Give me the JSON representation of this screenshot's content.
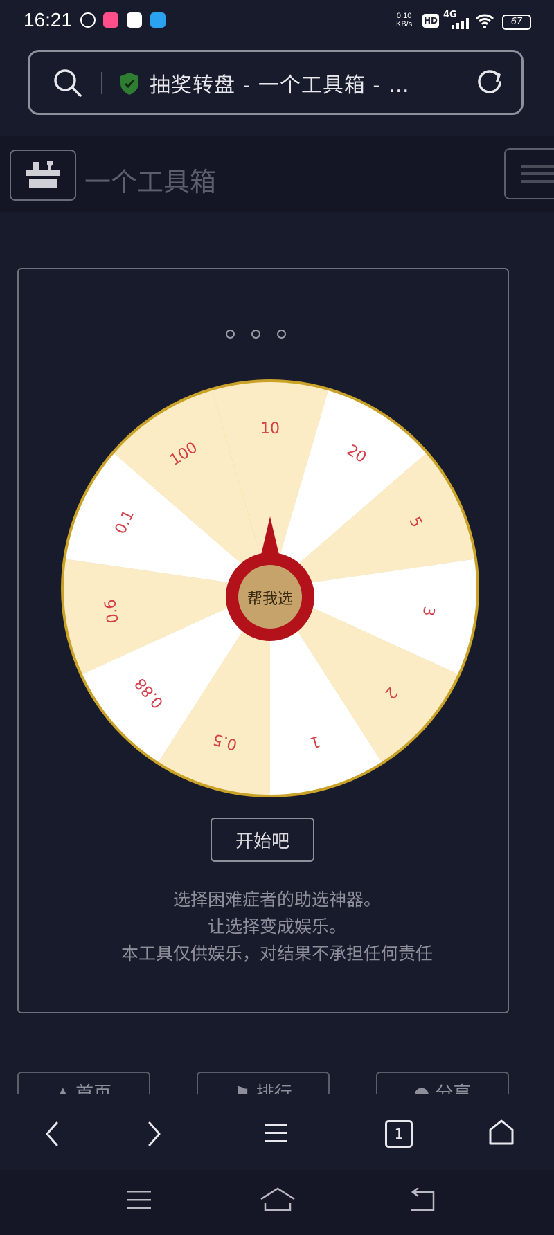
{
  "status_bar": {
    "time": "16:21",
    "speed_value": "0.10",
    "speed_unit": "KB/s",
    "hd": "HD",
    "network": "4G",
    "battery": "67"
  },
  "browser": {
    "url_title": "抽奖转盘 - 一个工具箱 - …",
    "icons": [
      "search-icon",
      "shield-check-icon",
      "refresh-icon"
    ]
  },
  "site": {
    "title": "一个工具箱"
  },
  "wheel": {
    "segments": [
      "10",
      "20",
      "5",
      "3",
      "2",
      "1",
      "0.5",
      "0.88",
      "0.6",
      "0.1",
      "100"
    ],
    "center_label": "帮我选",
    "colors": {
      "light": "#fbecc6",
      "white": "#ffffff",
      "text": "#d4404a",
      "rim": "#c9a227",
      "hub": "#b3121b"
    }
  },
  "start_button": "开始吧",
  "description": [
    "选择困难症者的助选神器。",
    "让选择变成娱乐。",
    "本工具仅供娱乐，对结果不承担任何责任"
  ],
  "bottom_nav": [
    {
      "label": "首页",
      "icon": "home-icon"
    },
    {
      "label": "排行",
      "icon": "flag-icon"
    },
    {
      "label": "分享",
      "icon": "share-icon"
    }
  ],
  "toolbar": {
    "tabs_count": "1"
  }
}
